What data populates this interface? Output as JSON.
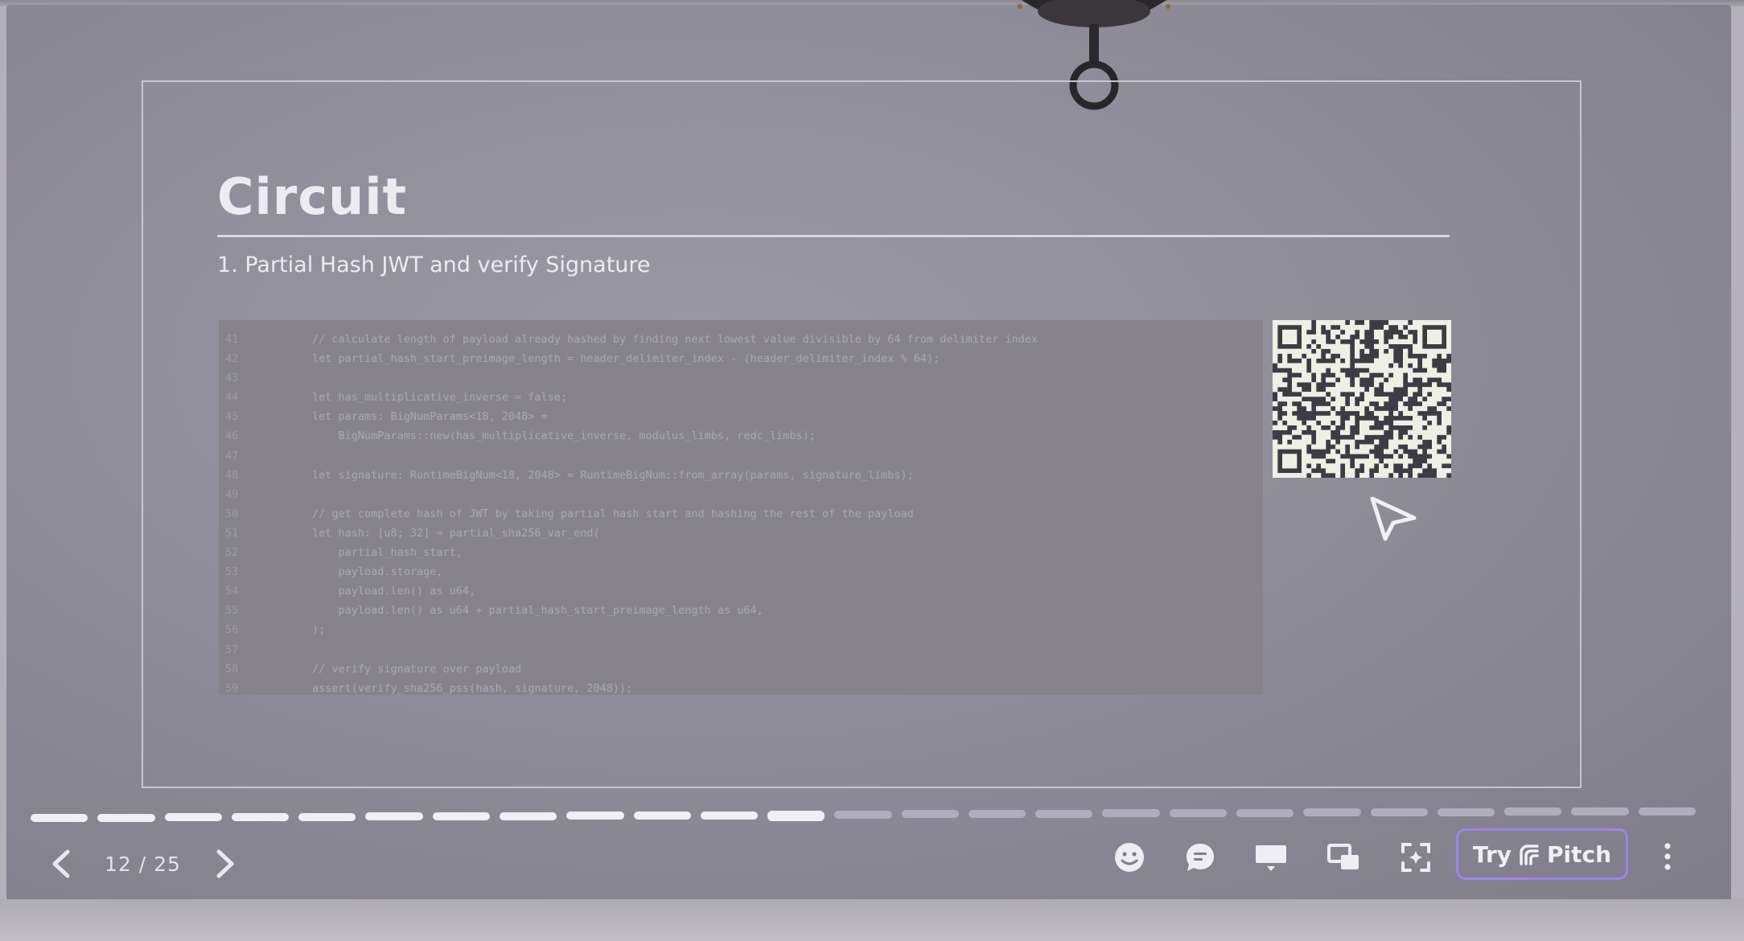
{
  "slide": {
    "title": "Circuit",
    "subtitle": "1. Partial Hash JWT and verify Signature"
  },
  "code": {
    "lines": [
      {
        "num": "41",
        "text": "// calculate length of payload already hashed by finding next lowest value divisible by 64 from delimiter index",
        "kind": "cm"
      },
      {
        "num": "42",
        "text": "let partial_hash_start_preimage_length = header_delimiter_index - (header_delimiter_index % 64);",
        "kind": "kw"
      },
      {
        "num": "43",
        "text": "",
        "kind": "kw"
      },
      {
        "num": "44",
        "text": "let has_multiplicative_inverse = false;",
        "kind": "kw"
      },
      {
        "num": "45",
        "text": "let params: BigNumParams<18, 2048> =",
        "kind": "ty"
      },
      {
        "num": "46",
        "text": "    BigNumParams::new(has_multiplicative_inverse, modulus_limbs, redc_limbs);",
        "kind": "ty"
      },
      {
        "num": "47",
        "text": "",
        "kind": "kw"
      },
      {
        "num": "48",
        "text": "let signature: RuntimeBigNum<18, 2048> = RuntimeBigNum::from_array(params, signature_limbs);",
        "kind": "ty"
      },
      {
        "num": "49",
        "text": "",
        "kind": "kw"
      },
      {
        "num": "50",
        "text": "// get complete hash of JWT by taking partial hash start and hashing the rest of the payload",
        "kind": "cm"
      },
      {
        "num": "51",
        "text": "let hash: [u8; 32] = partial_sha256_var_end(",
        "kind": "ty"
      },
      {
        "num": "52",
        "text": "    partial_hash_start,",
        "kind": "kw"
      },
      {
        "num": "53",
        "text": "    payload.storage,",
        "kind": "kw"
      },
      {
        "num": "54",
        "text": "    payload.len() as u64,",
        "kind": "kw"
      },
      {
        "num": "55",
        "text": "    payload.len() as u64 + partial_hash_start_preimage_length as u64,",
        "kind": "kw"
      },
      {
        "num": "56",
        "text": ");",
        "kind": "kw"
      },
      {
        "num": "57",
        "text": "",
        "kind": "kw"
      },
      {
        "num": "58",
        "text": "// verify signature over payload",
        "kind": "cm"
      },
      {
        "num": "59",
        "text": "assert(verify_sha256_pss(hash, signature, 2048));",
        "kind": "ty"
      }
    ]
  },
  "navigation": {
    "counter": "12 / 25",
    "current": 12,
    "total": 25,
    "prev_icon": "chevron-left-icon",
    "next_icon": "chevron-right-icon"
  },
  "toolbar": {
    "icons": [
      "emoji-icon",
      "comment-icon",
      "present-icon",
      "screens-icon",
      "focus-icon",
      "more-vertical-icon"
    ],
    "try_label": "Try",
    "pitch_label": "Pitch"
  },
  "colors": {
    "accent": "#9d83ef",
    "progress_done": "#f1eff6",
    "progress_todo": "#b0adbc"
  }
}
